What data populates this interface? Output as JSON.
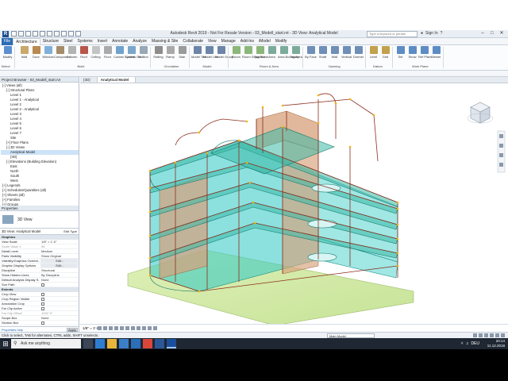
{
  "window": {
    "title": "Autodesk Revit 2019 - Not For Resale Version - 03_Modell_start.rvt - 3D View: Analytical Model",
    "search_placeholder": "Type a keyword or phrase",
    "signin": "Sign In"
  },
  "ribbon_tabs": [
    "File",
    "Architecture",
    "Structure",
    "Steel",
    "Systems",
    "Insert",
    "Annotate",
    "Analyze",
    "Massing & Site",
    "Collaborate",
    "View",
    "Manage",
    "Add-Ins",
    "iModel",
    "Modify"
  ],
  "ribbon_tools": [
    {
      "label": "Modify",
      "icon": "cursor-icon",
      "color": "#5b8fd0"
    },
    {
      "label": "Wall",
      "icon": "wall-icon",
      "color": "#c9a86a"
    },
    {
      "label": "Door",
      "icon": "door-icon",
      "color": "#b98a4f"
    },
    {
      "label": "Window",
      "icon": "window-icon",
      "color": "#7fb0d8"
    },
    {
      "label": "Component",
      "icon": "component-icon",
      "color": "#a58c6b"
    },
    {
      "label": "Column",
      "icon": "column-icon",
      "color": "#b3b3b3"
    },
    {
      "label": "Roof",
      "icon": "roof-icon",
      "color": "#b8564b"
    },
    {
      "label": "Ceiling",
      "icon": "ceiling-icon",
      "color": "#c4c4c4"
    },
    {
      "label": "Floor",
      "icon": "floor-icon",
      "color": "#aaaaaa"
    },
    {
      "label": "Curtain System",
      "icon": "curtain-system-icon",
      "color": "#6fa3cf"
    },
    {
      "label": "Curtain Grid",
      "icon": "curtain-grid-icon",
      "color": "#7aa7c9"
    },
    {
      "label": "Mullion",
      "icon": "mullion-icon",
      "color": "#9aa8b5"
    },
    {
      "label": "Railing",
      "icon": "railing-icon",
      "color": "#8d8d8d"
    },
    {
      "label": "Ramp",
      "icon": "ramp-icon",
      "color": "#a9a9a9"
    },
    {
      "label": "Stair",
      "icon": "stair-icon",
      "color": "#9b9b9b"
    },
    {
      "label": "Model Text",
      "icon": "model-text-icon",
      "color": "#6d86a8"
    },
    {
      "label": "Model Line",
      "icon": "model-line-icon",
      "color": "#6d86a8"
    },
    {
      "label": "Model Group",
      "icon": "model-group-icon",
      "color": "#6d86a8"
    },
    {
      "label": "Room",
      "icon": "room-icon",
      "color": "#8bb77a"
    },
    {
      "label": "Room Separator",
      "icon": "room-separator-icon",
      "color": "#8bb77a"
    },
    {
      "label": "Tag Room",
      "icon": "tag-room-icon",
      "color": "#8bb77a"
    },
    {
      "label": "Area",
      "icon": "area-icon",
      "color": "#7cab9c"
    },
    {
      "label": "Area Boundary",
      "icon": "area-boundary-icon",
      "color": "#7cab9c"
    },
    {
      "label": "Tag Area",
      "icon": "tag-area-icon",
      "color": "#7cab9c"
    },
    {
      "label": "By Face",
      "icon": "by-face-icon",
      "color": "#6f8fb8"
    },
    {
      "label": "Shaft",
      "icon": "shaft-icon",
      "color": "#6f8fb8"
    },
    {
      "label": "Wall",
      "icon": "opening-wall-icon",
      "color": "#6f8fb8"
    },
    {
      "label": "Vertical",
      "icon": "vertical-icon",
      "color": "#6f8fb8"
    },
    {
      "label": "Dormer",
      "icon": "dormer-icon",
      "color": "#6f8fb8"
    },
    {
      "label": "Level",
      "icon": "level-icon",
      "color": "#c2a14d"
    },
    {
      "label": "Grid",
      "icon": "grid-icon",
      "color": "#c2a14d"
    },
    {
      "label": "Set",
      "icon": "set-icon",
      "color": "#5d8cc4"
    },
    {
      "label": "Show",
      "icon": "show-icon",
      "color": "#5d8cc4"
    },
    {
      "label": "Ref Plane",
      "icon": "ref-plane-icon",
      "color": "#5d8cc4"
    },
    {
      "label": "Viewer",
      "icon": "viewer-icon",
      "color": "#5d8cc4"
    }
  ],
  "ribbon_groups": [
    "Select",
    "Build",
    "Circulation",
    "Model",
    "Room & Area",
    "Opening",
    "Datum",
    "Work Plane"
  ],
  "browser": {
    "header": "Project Browser - 03_Modell_start.rvt",
    "nodes": [
      "[-] Views (all)",
      "[-] Structural Plans",
      "Level 1",
      "Level 1 - Analytical",
      "Level 2",
      "Level 2 - Analytical",
      "Level 3",
      "Level 4",
      "Level 5",
      "Level 6",
      "Level 7",
      "Site",
      "[+] Floor Plans",
      "[-] 3D Views",
      "Analytical Model",
      "{3D}",
      "[-] Elevations (Building Elevation)",
      "East",
      "North",
      "South",
      "West",
      "[+] Legends",
      "[+] Schedules/Quantities (all)",
      "[+] Sheets (all)",
      "[+] Families",
      "[+] Groups"
    ],
    "selected_index": 14
  },
  "properties": {
    "header": "Properties",
    "type_name": "3D View",
    "selector": "3D View: Analytical Model",
    "edit_type": "Edit Type",
    "sections": [
      {
        "title": "Graphics",
        "rows": [
          [
            "View Scale",
            "1/8\" = 1'-0\"",
            ""
          ],
          [
            "Scale Value 1:",
            "96",
            "grey"
          ],
          [
            "Detail Level",
            "Medium",
            ""
          ],
          [
            "Parts Visibility",
            "Show Original",
            ""
          ],
          [
            "Visibility/Graphics Overrid...",
            "Edit...",
            "btn"
          ],
          [
            "Graphic Display Options",
            "Edit...",
            "btn"
          ],
          [
            "Discipline",
            "Structural",
            ""
          ],
          [
            "Show Hidden Lines",
            "By Discipline",
            ""
          ],
          [
            "Default Analysis Display S...",
            "None",
            ""
          ],
          [
            "Sun Path",
            "",
            "chk"
          ]
        ]
      },
      {
        "title": "Extents",
        "rows": [
          [
            "Crop View",
            "",
            "chk"
          ],
          [
            "Crop Region Visible",
            "",
            "chk"
          ],
          [
            "Annotation Crop",
            "",
            "chk"
          ],
          [
            "Far Clip Active",
            "",
            "chk"
          ],
          [
            "Far Clip Offset",
            "1000' 0\"",
            "grey"
          ],
          [
            "Scope Box",
            "None",
            ""
          ],
          [
            "Section Box",
            "",
            "chk"
          ]
        ]
      }
    ],
    "help_link": "Properties help",
    "apply": "Apply"
  },
  "view_tabs": [
    "{3D}",
    "Analytical Model"
  ],
  "view_scale": "1/8\" = 1'-0\"",
  "status": {
    "message": "Click to select, TAB for alternates, CTRL adds, SHIFT unselects.",
    "model": "Main Model"
  },
  "taskbar": {
    "search_placeholder": "Ask me anything",
    "time": "20:14",
    "date": "11.12.2018",
    "lang": "DEU"
  },
  "colors": {
    "wall": "#2ec9c4",
    "slab": "#3db9a6",
    "core": "#d7a07a",
    "frame": "#8b2d1c",
    "node": "#f0b400",
    "ground": "#c9e6a0"
  }
}
